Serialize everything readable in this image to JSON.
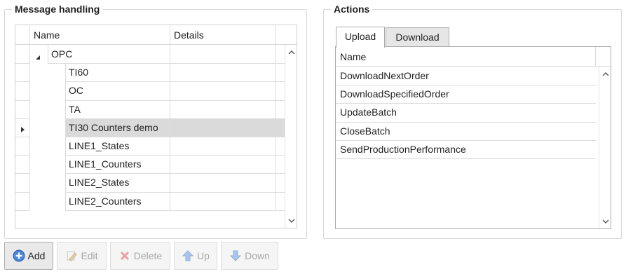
{
  "message_handling": {
    "title": "Message handling",
    "columns": {
      "name": "Name",
      "details": "Details"
    },
    "root": {
      "label": "OPC",
      "expanded": true
    },
    "items": [
      {
        "label": "TI60",
        "details": ""
      },
      {
        "label": "OC",
        "details": ""
      },
      {
        "label": "TA",
        "details": ""
      },
      {
        "label": "TI30 Counters demo",
        "details": "",
        "selected": true
      },
      {
        "label": "LINE1_States",
        "details": ""
      },
      {
        "label": "LINE1_Counters",
        "details": ""
      },
      {
        "label": "LINE2_States",
        "details": ""
      },
      {
        "label": "LINE2_Counters",
        "details": ""
      }
    ]
  },
  "actions": {
    "title": "Actions",
    "tabs": [
      {
        "label": "Upload",
        "active": true
      },
      {
        "label": "Download",
        "active": false
      }
    ],
    "column": "Name",
    "items": [
      "DownloadNextOrder",
      "DownloadSpecifiedOrder",
      "UpdateBatch",
      "CloseBatch",
      "SendProductionPerformance"
    ]
  },
  "toolbar": {
    "add": {
      "label": "Add",
      "icon": "plus-circle-icon",
      "enabled": true
    },
    "edit": {
      "label": "Edit",
      "icon": "pencil-icon",
      "enabled": false
    },
    "delete": {
      "label": "Delete",
      "icon": "x-icon",
      "enabled": false
    },
    "up": {
      "label": "Up",
      "icon": "arrow-up-icon",
      "enabled": false
    },
    "down": {
      "label": "Down",
      "icon": "arrow-down-icon",
      "enabled": false
    }
  },
  "colors": {
    "selected_row": "#dadada",
    "accent_blue": "#3a7bd5",
    "delete_red": "#e06060"
  }
}
